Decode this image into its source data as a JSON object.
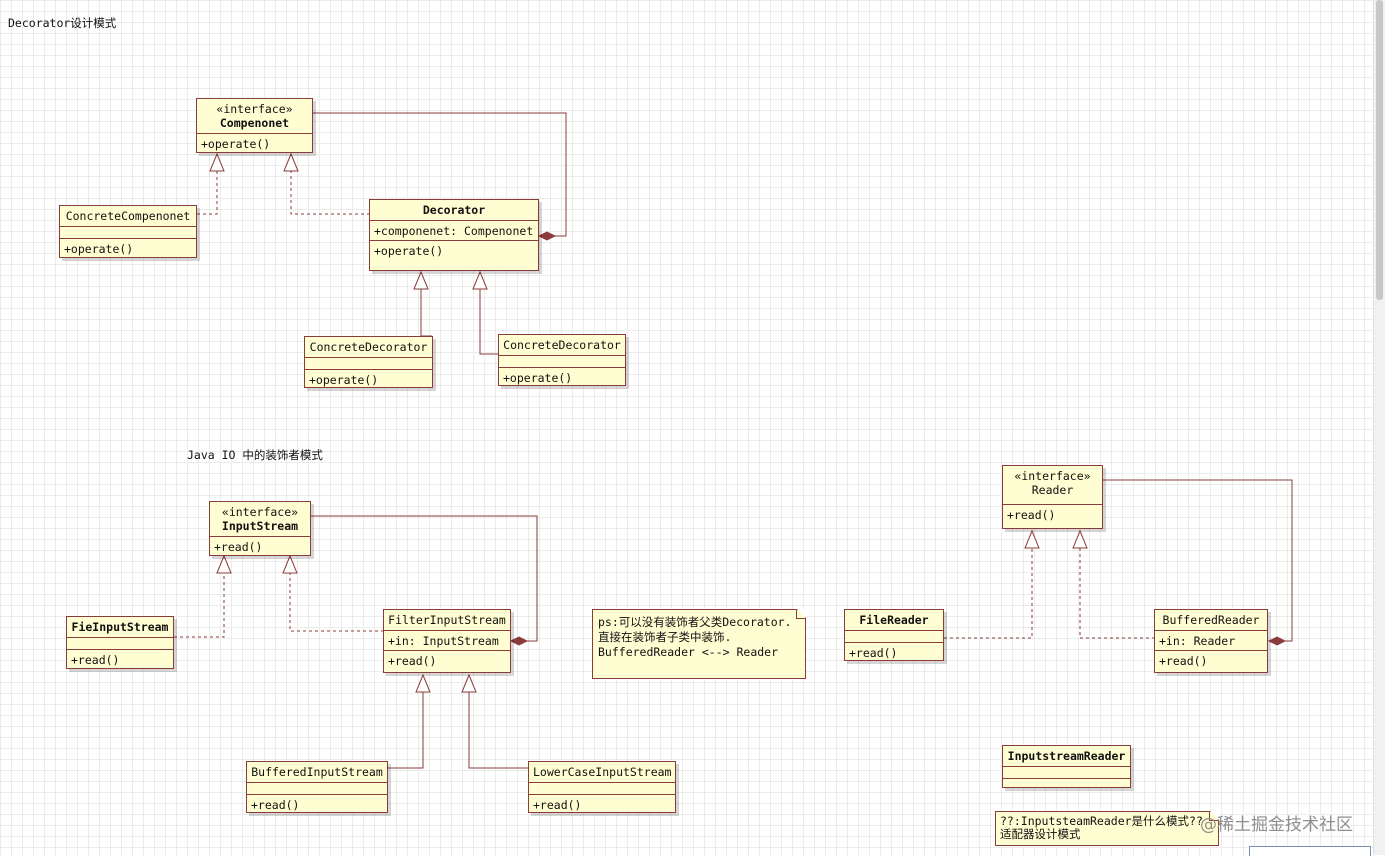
{
  "diagram_title": "Decorator设计模式",
  "io_title": "Java IO 中的装饰者模式",
  "classes": {
    "componenet": {
      "stereotype": "«interface»",
      "name": "Compenonet",
      "attrs": [],
      "ops": [
        "+operate()"
      ]
    },
    "concrete_componenet": {
      "stereotype": "",
      "name": "ConcreteCompenonet",
      "attrs": [],
      "ops": [
        "+operate()"
      ]
    },
    "decorator": {
      "stereotype": "",
      "name": "Decorator",
      "attrs": [
        "+componenet: Compenonet"
      ],
      "ops": [
        "+operate()"
      ]
    },
    "concrete_decorator_1": {
      "stereotype": "",
      "name": "ConcreteDecorator",
      "attrs": [],
      "ops": [
        "+operate()"
      ]
    },
    "concrete_decorator_2": {
      "stereotype": "",
      "name": "ConcreteDecorator",
      "attrs": [],
      "ops": [
        "+operate()"
      ]
    },
    "inputstream": {
      "stereotype": "«interface»",
      "name": "InputStream",
      "attrs": [],
      "ops": [
        "+read()"
      ]
    },
    "fieinputstream": {
      "stereotype": "",
      "name": "FieInputStream",
      "attrs": [],
      "ops": [
        "+read()"
      ]
    },
    "filterinputstream": {
      "stereotype": "",
      "name": "FilterInputStream",
      "attrs": [
        "+in: InputStream"
      ],
      "ops": [
        "+read()"
      ]
    },
    "bufferedinputstream": {
      "stereotype": "",
      "name": "BufferedInputStream",
      "attrs": [],
      "ops": [
        "+read()"
      ]
    },
    "lowercaseinputstream": {
      "stereotype": "",
      "name": "LowerCaseInputStream",
      "attrs": [],
      "ops": [
        "+read()"
      ]
    },
    "reader": {
      "stereotype": "«interface»",
      "name": "Reader",
      "attrs": [],
      "ops": [
        "+read()"
      ]
    },
    "filereader": {
      "stereotype": "",
      "name": "FileReader",
      "attrs": [],
      "ops": [
        "+read()"
      ]
    },
    "bufferedreader": {
      "stereotype": "",
      "name": "BufferedReader",
      "attrs": [
        "+in: Reader"
      ],
      "ops": [
        "+read()"
      ]
    },
    "inputstreamreader": {
      "stereotype": "",
      "name": "InputstreamReader",
      "attrs": [],
      "ops": []
    }
  },
  "notes": {
    "decorator_note": [
      "ps:可以没有装饰者父类Decorator.",
      "直接在装饰者子类中装饰.",
      "BufferedReader <--> Reader"
    ],
    "adapter_note": [
      "??:InputsteamReader是什么模式??",
      "适配器设计模式"
    ]
  },
  "watermark": "@稀土掘金技术社区",
  "colors": {
    "box_fill": "#fffdd2",
    "line": "#8a3b3b",
    "grid": "#ececec"
  }
}
